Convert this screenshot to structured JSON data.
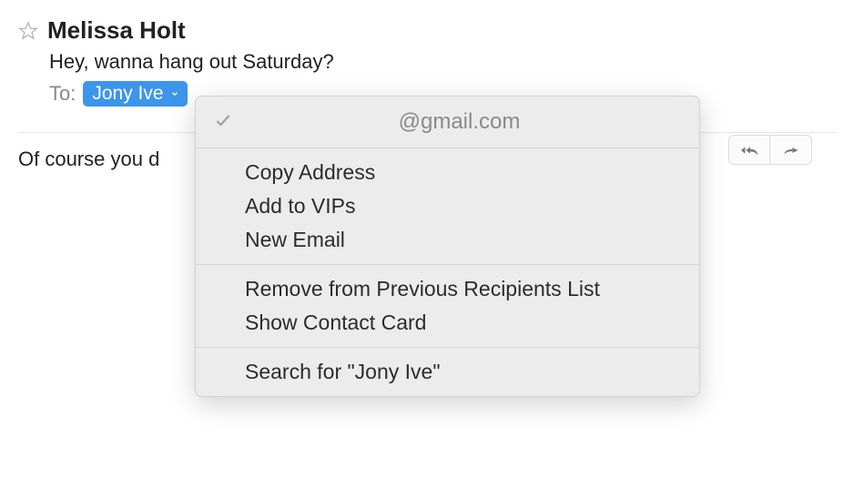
{
  "sender": {
    "name": "Melissa Holt"
  },
  "subject": "Hey, wanna hang out Saturday?",
  "to": {
    "label": "To:",
    "recipient_name": "Jony Ive"
  },
  "body": {
    "visible_text": "Of course you d"
  },
  "context_menu": {
    "header": "@gmail.com",
    "section1": {
      "copy_address": "Copy Address",
      "add_to_vips": "Add to VIPs",
      "new_email": "New Email"
    },
    "section2": {
      "remove_from_list": "Remove from Previous Recipients List",
      "show_contact_card": "Show Contact Card"
    },
    "section3": {
      "search": "Search for \"Jony Ive\""
    }
  }
}
